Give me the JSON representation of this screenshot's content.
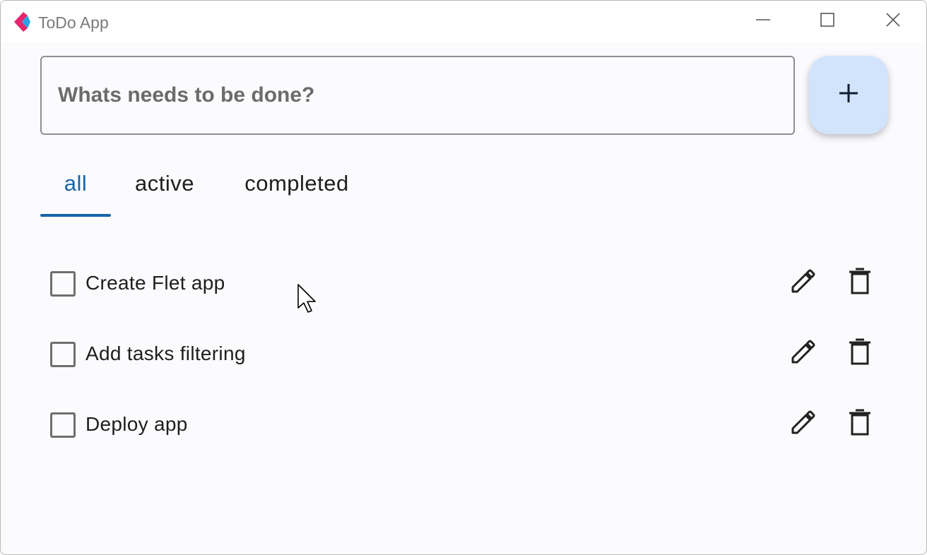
{
  "window": {
    "title": "ToDo App",
    "logo_icon": "flet-logo-icon",
    "controls": [
      "minimize-icon",
      "maximize-icon",
      "close-icon"
    ]
  },
  "new_task": {
    "placeholder": "Whats needs to be done?",
    "value": "",
    "add_button_icon": "plus-icon"
  },
  "tabs": [
    {
      "label": "all",
      "selected": true
    },
    {
      "label": "active",
      "selected": false
    },
    {
      "label": "completed",
      "selected": false
    }
  ],
  "tasks": [
    {
      "name": "Create Flet app",
      "completed": false
    },
    {
      "name": "Add tasks filtering",
      "completed": false
    },
    {
      "name": "Deploy app",
      "completed": false
    }
  ],
  "task_actions": {
    "edit_icon": "pencil-icon",
    "delete_icon": "trash-icon"
  },
  "colors": {
    "accent": "#1565a8",
    "fab_background": "#d2e3fc",
    "window_background": "#fbfbfe",
    "logo_pink": "#e8256f",
    "logo_blue": "#2aa3e6"
  }
}
